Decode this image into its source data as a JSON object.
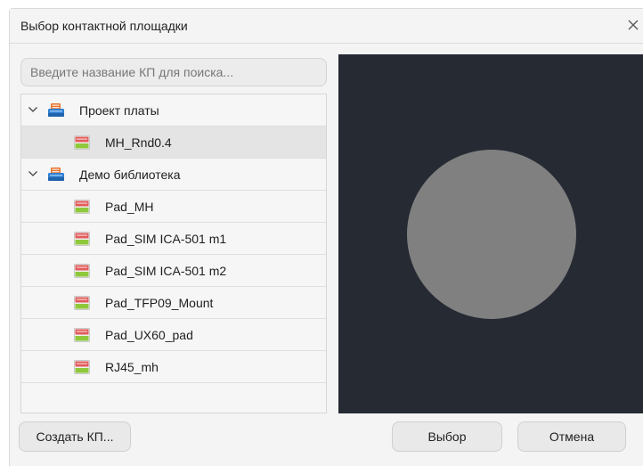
{
  "dialog": {
    "title": "Выбор контактной площадки",
    "close_icon": "close-icon"
  },
  "search": {
    "placeholder": "Введите название КП для поиска..."
  },
  "tree": {
    "groups": [
      {
        "label": "Проект платы",
        "expanded": true,
        "icon": "database-icon",
        "items": [
          {
            "label": "MH_Rnd0.4",
            "selected": true,
            "icon": "pad-icon"
          }
        ]
      },
      {
        "label": "Демо библиотека",
        "expanded": true,
        "icon": "database-icon",
        "items": [
          {
            "label": "Pad_MH",
            "icon": "pad-icon"
          },
          {
            "label": "Pad_SIM ICA-501 m1",
            "icon": "pad-icon"
          },
          {
            "label": "Pad_SIM ICA-501 m2",
            "icon": "pad-icon"
          },
          {
            "label": "Pad_TFP09_Mount",
            "icon": "pad-icon"
          },
          {
            "label": "Pad_UX60_pad",
            "icon": "pad-icon"
          },
          {
            "label": "RJ45_mh",
            "icon": "pad-icon"
          }
        ]
      }
    ]
  },
  "preview": {
    "background": "#252a33",
    "shape": "circle",
    "shape_color": "#808080"
  },
  "buttons": {
    "create": "Создать КП...",
    "select": "Выбор",
    "cancel": "Отмена"
  }
}
